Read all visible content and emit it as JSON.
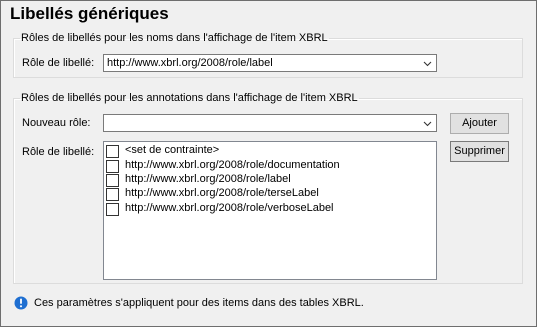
{
  "dialog": {
    "title": "Libellés génériques"
  },
  "names_group": {
    "legend": "Rôles de libellés pour les noms dans l'affichage de l'item XBRL",
    "role_label": "Rôle de libellé:",
    "role_value": "http://www.xbrl.org/2008/role/label"
  },
  "annotations_group": {
    "legend": "Rôles de libellés pour les annotations dans l'affichage de l'item XBRL",
    "new_role_label": "Nouveau rôle:",
    "new_role_value": "",
    "role_label": "Rôle de libellé:",
    "add_button": "Ajouter",
    "delete_button": "Supprimer",
    "roles": [
      {
        "label": "<set de contrainte>",
        "checked": false
      },
      {
        "label": "http://www.xbrl.org/2008/role/documentation",
        "checked": false
      },
      {
        "label": "http://www.xbrl.org/2008/role/label",
        "checked": false
      },
      {
        "label": "http://www.xbrl.org/2008/role/terseLabel",
        "checked": false
      },
      {
        "label": "http://www.xbrl.org/2008/role/verboseLabel",
        "checked": false
      }
    ]
  },
  "footer": {
    "icon": "info-icon",
    "note": "Ces paramètres s'appliquent pour des items dans des tables XBRL."
  },
  "colors": {
    "dialog_bg": "#f0f0f0",
    "info_icon": "#1f6fd1"
  }
}
